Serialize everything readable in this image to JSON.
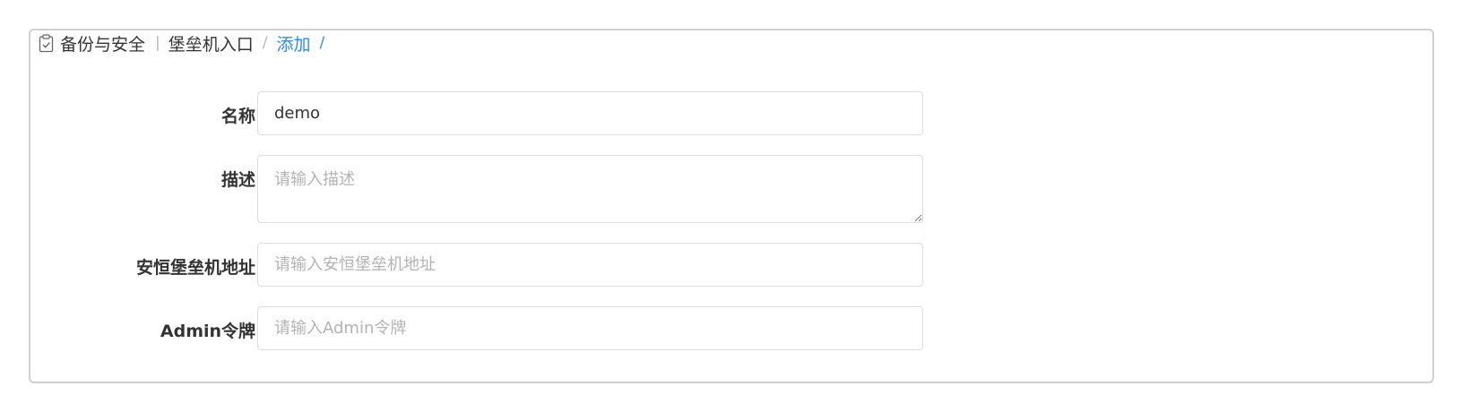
{
  "breadcrumb": {
    "icon": "clipboard-check-icon",
    "section": "备份与安全",
    "page": "堡垒机入口",
    "current": "添加",
    "separator_bar": "|",
    "separator_slash": "/"
  },
  "form": {
    "name": {
      "label": "名称",
      "required_mark": "*",
      "value": "demo",
      "placeholder": ""
    },
    "description": {
      "label": "描述",
      "value": "",
      "placeholder": "请输入描述"
    },
    "address": {
      "label": "安恒堡垒机地址",
      "required_mark": "*",
      "value": "",
      "placeholder": "请输入安恒堡垒机地址"
    },
    "admin_token": {
      "label": "Admin令牌",
      "required_mark": "*",
      "value": "",
      "placeholder": "请输入Admin令牌"
    }
  },
  "colors": {
    "accent": "#2d8cf0",
    "required": "#ed4014",
    "border": "#dcdee2"
  }
}
